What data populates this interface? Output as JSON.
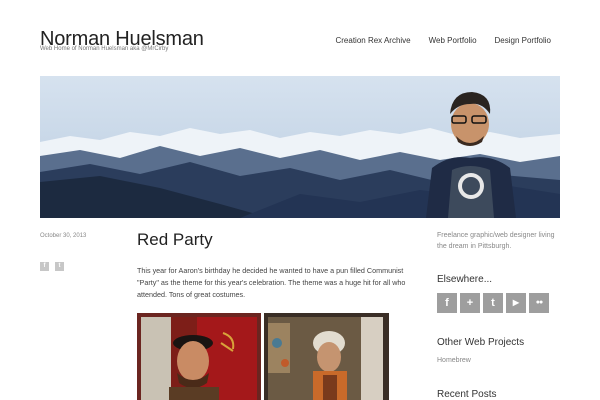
{
  "site": {
    "title": "Norman Huelsman",
    "tagline": "Web Home of Norman Huelsman aka @MrCirby"
  },
  "nav": {
    "items": [
      "Creation Rex Archive",
      "Web Portfolio",
      "Design Portfolio"
    ]
  },
  "post": {
    "date": "October 30, 2013",
    "title": "Red Party",
    "body": "This year for Aaron's birthday he decided he wanted to have a pun filled Communist \"Party\" as the theme for this year's celebration. The theme was a huge hit for all who attended. Tons of great costumes.",
    "share_icons": [
      "facebook-icon",
      "twitter-icon"
    ]
  },
  "sidebar": {
    "intro": "Freelance graphic/web designer living the dream in Pittsburgh.",
    "elsewhere_heading": "Elsewhere...",
    "social_icons": [
      {
        "name": "facebook-icon",
        "glyph": "f"
      },
      {
        "name": "google-plus-icon",
        "glyph": "+"
      },
      {
        "name": "twitter-icon",
        "glyph": "t"
      },
      {
        "name": "youtube-icon",
        "glyph": "▶"
      },
      {
        "name": "flickr-icon",
        "glyph": "●●"
      }
    ],
    "projects_heading": "Other Web Projects",
    "projects_link": "Homebrew",
    "recent_heading": "Recent Posts"
  },
  "colors": {
    "sky": "#c9d9ea",
    "mountain_dark": "#2b3d5c",
    "snow": "#eef3f8",
    "icon_gray": "#9e9e9e"
  }
}
